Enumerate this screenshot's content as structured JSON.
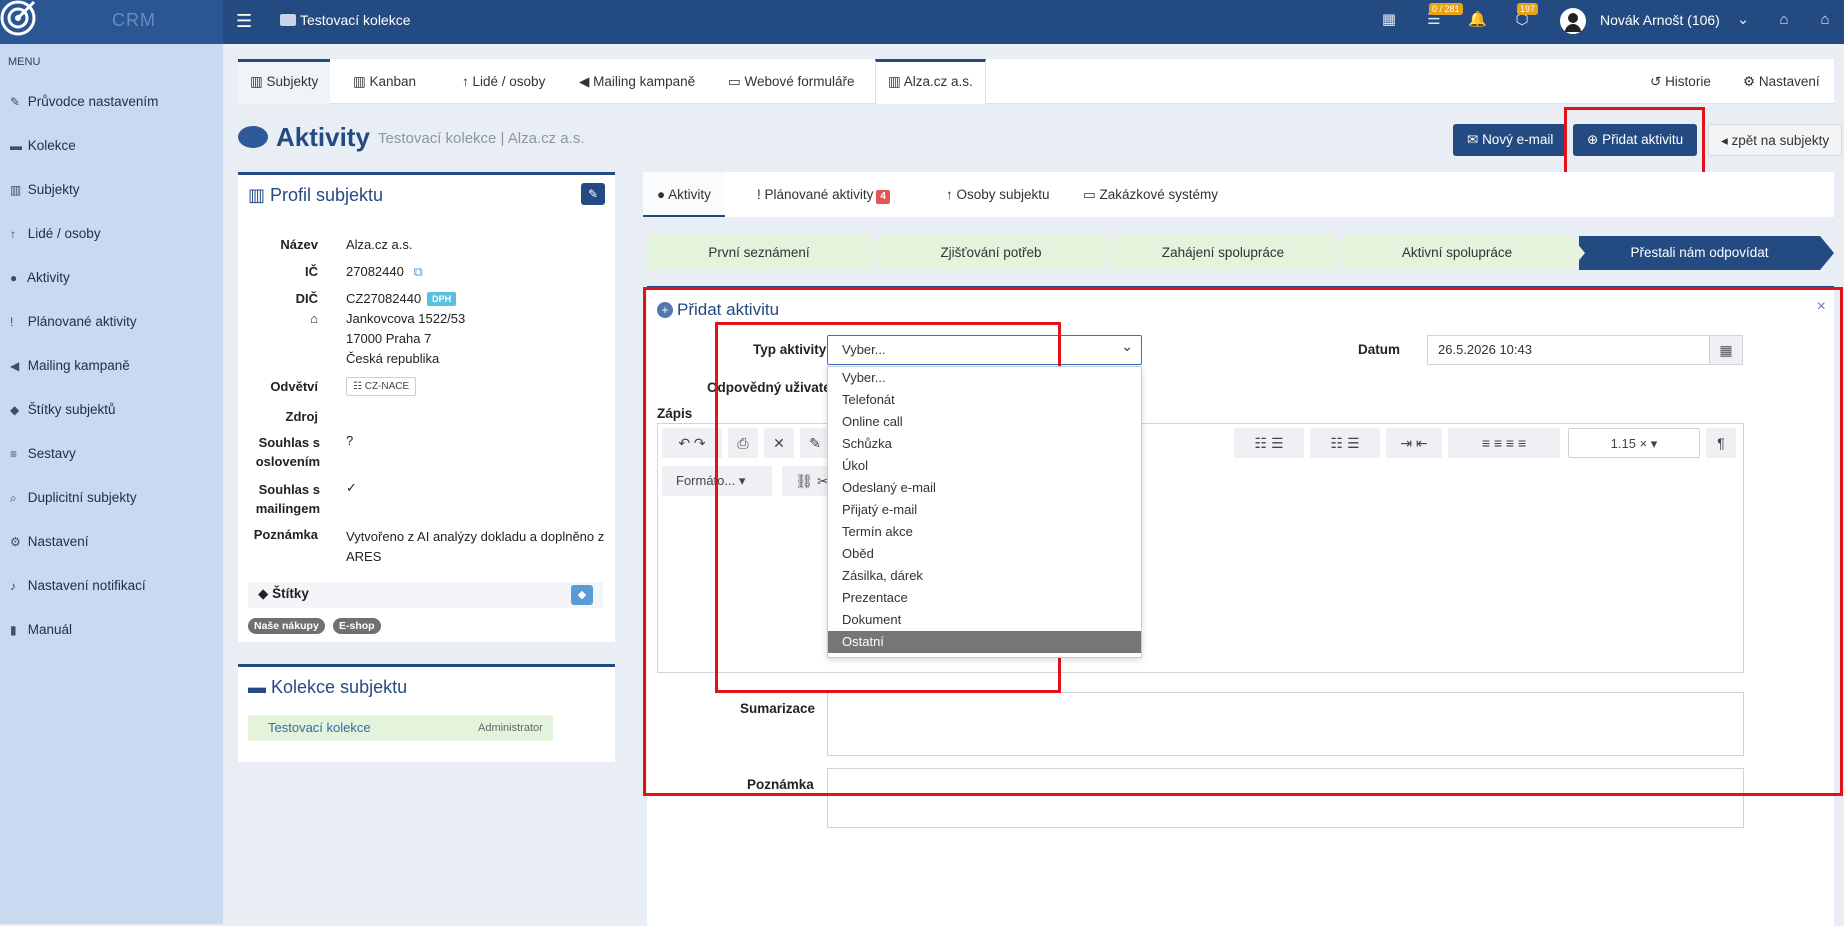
{
  "app": {
    "logo_text": "CRM",
    "collection_title": "Testovací kolekce"
  },
  "topbar": {
    "tasks_badge": "0 / 281",
    "notif_badge": "197",
    "user_name": "Novák Arnošt (106)"
  },
  "sidebar": {
    "menu_label": "MENU",
    "items": [
      {
        "label": "Průvodce nastavením",
        "icon": "pencil-icon"
      },
      {
        "label": "Kolekce",
        "icon": "folder-icon"
      },
      {
        "label": "Subjekty",
        "icon": "building-icon"
      },
      {
        "label": "Lidé / osoby",
        "icon": "person-icon"
      },
      {
        "label": "Aktivity",
        "icon": "chat-icon"
      },
      {
        "label": "Plánované aktivity",
        "icon": "alert-icon"
      },
      {
        "label": "Mailing kampaně",
        "icon": "megaphone-icon"
      },
      {
        "label": "Štítky subjektů",
        "icon": "tag-icon"
      },
      {
        "label": "Sestavy",
        "icon": "list-icon"
      },
      {
        "label": "Duplicitní subjekty",
        "icon": "search-icon"
      },
      {
        "label": "Nastavení",
        "icon": "gear-icon"
      },
      {
        "label": "Nastavení notifikací",
        "icon": "bell-icon"
      },
      {
        "label": "Manuál",
        "icon": "book-icon"
      }
    ]
  },
  "top_tabs": [
    "Subjekty",
    "Kanban",
    "Lidé / osoby",
    "Mailing kampaně",
    "Webové formuláře",
    "Alza.cz a.s."
  ],
  "top_right_links": {
    "history": "Historie",
    "settings": "Nastavení"
  },
  "page": {
    "title": "Aktivity",
    "subtitle": "Testovací kolekce | Alza.cz a.s.",
    "btn_new_email": "Nový e-mail",
    "btn_add_activity": "Přidat aktivitu",
    "btn_back": "zpět na subjekty"
  },
  "profile": {
    "title": "Profil subjektu",
    "labels": {
      "name": "Název",
      "ic": "IČ",
      "dic": "DIČ",
      "odvetvi": "Odvětví",
      "zdroj": "Zdroj",
      "souhlas_osl": "Souhlas s oslovením",
      "souhlas_mail": "Souhlas s mailingem",
      "poznamka": "Poznámka"
    },
    "name": "Alza.cz a.s.",
    "ic": "27082440",
    "dic": "CZ27082440",
    "dph_badge": "DPH",
    "address1": "Jankovcova 1522/53",
    "address2": "17000 Praha 7",
    "address3": "Česká republika",
    "nace_btn": "CZ-NACE",
    "souhlas_osl": "?",
    "souhlas_mail": "✓",
    "poznamka": "Vytvořeno z AI analýzy dokladu a doplněno z ARES",
    "stitky_label": "Štítky",
    "tags": [
      "Naše nákupy",
      "E-shop"
    ]
  },
  "kolekce_card": {
    "title": "Kolekce subjektu",
    "row_name": "Testovací kolekce",
    "row_role": "Administrator"
  },
  "right_tabs": {
    "aktivity": "Aktivity",
    "planovane": "Plánované aktivity",
    "planovane_count": "4",
    "osoby": "Osoby subjektu",
    "zakazkove": "Zakázkové systémy"
  },
  "pipeline": [
    "První seznámení",
    "Zjišťování potřeb",
    "Zahájení spolupráce",
    "Aktivní spolupráce",
    "Přestali nám odpovídat"
  ],
  "form": {
    "title": "Přidat aktivitu",
    "typ_label": "Typ aktivity",
    "typ_value": "Vyber...",
    "datum_label": "Datum",
    "datum_value": "26.5.2026 10:43",
    "odpovedny_label": "Odpovědný uživatel",
    "zapis_label": "Zápis",
    "format_label": "Formáto...",
    "line_height": "1.15",
    "sumarizace_label": "Sumarizace",
    "poznamka_label": "Poznámka",
    "options": [
      "Vyber...",
      "Telefonát",
      "Online call",
      "Schůzka",
      "Úkol",
      "Odeslaný e-mail",
      "Přijatý e-mail",
      "Termín akce",
      "Oběd",
      "Zásilka, dárek",
      "Prezentace",
      "Dokument",
      "Ostatní"
    ],
    "selected_option": "Ostatní"
  },
  "colors": {
    "primary": "#244a82",
    "highlight": "#e0121a",
    "pipeline_done": "#e3f3dc"
  }
}
